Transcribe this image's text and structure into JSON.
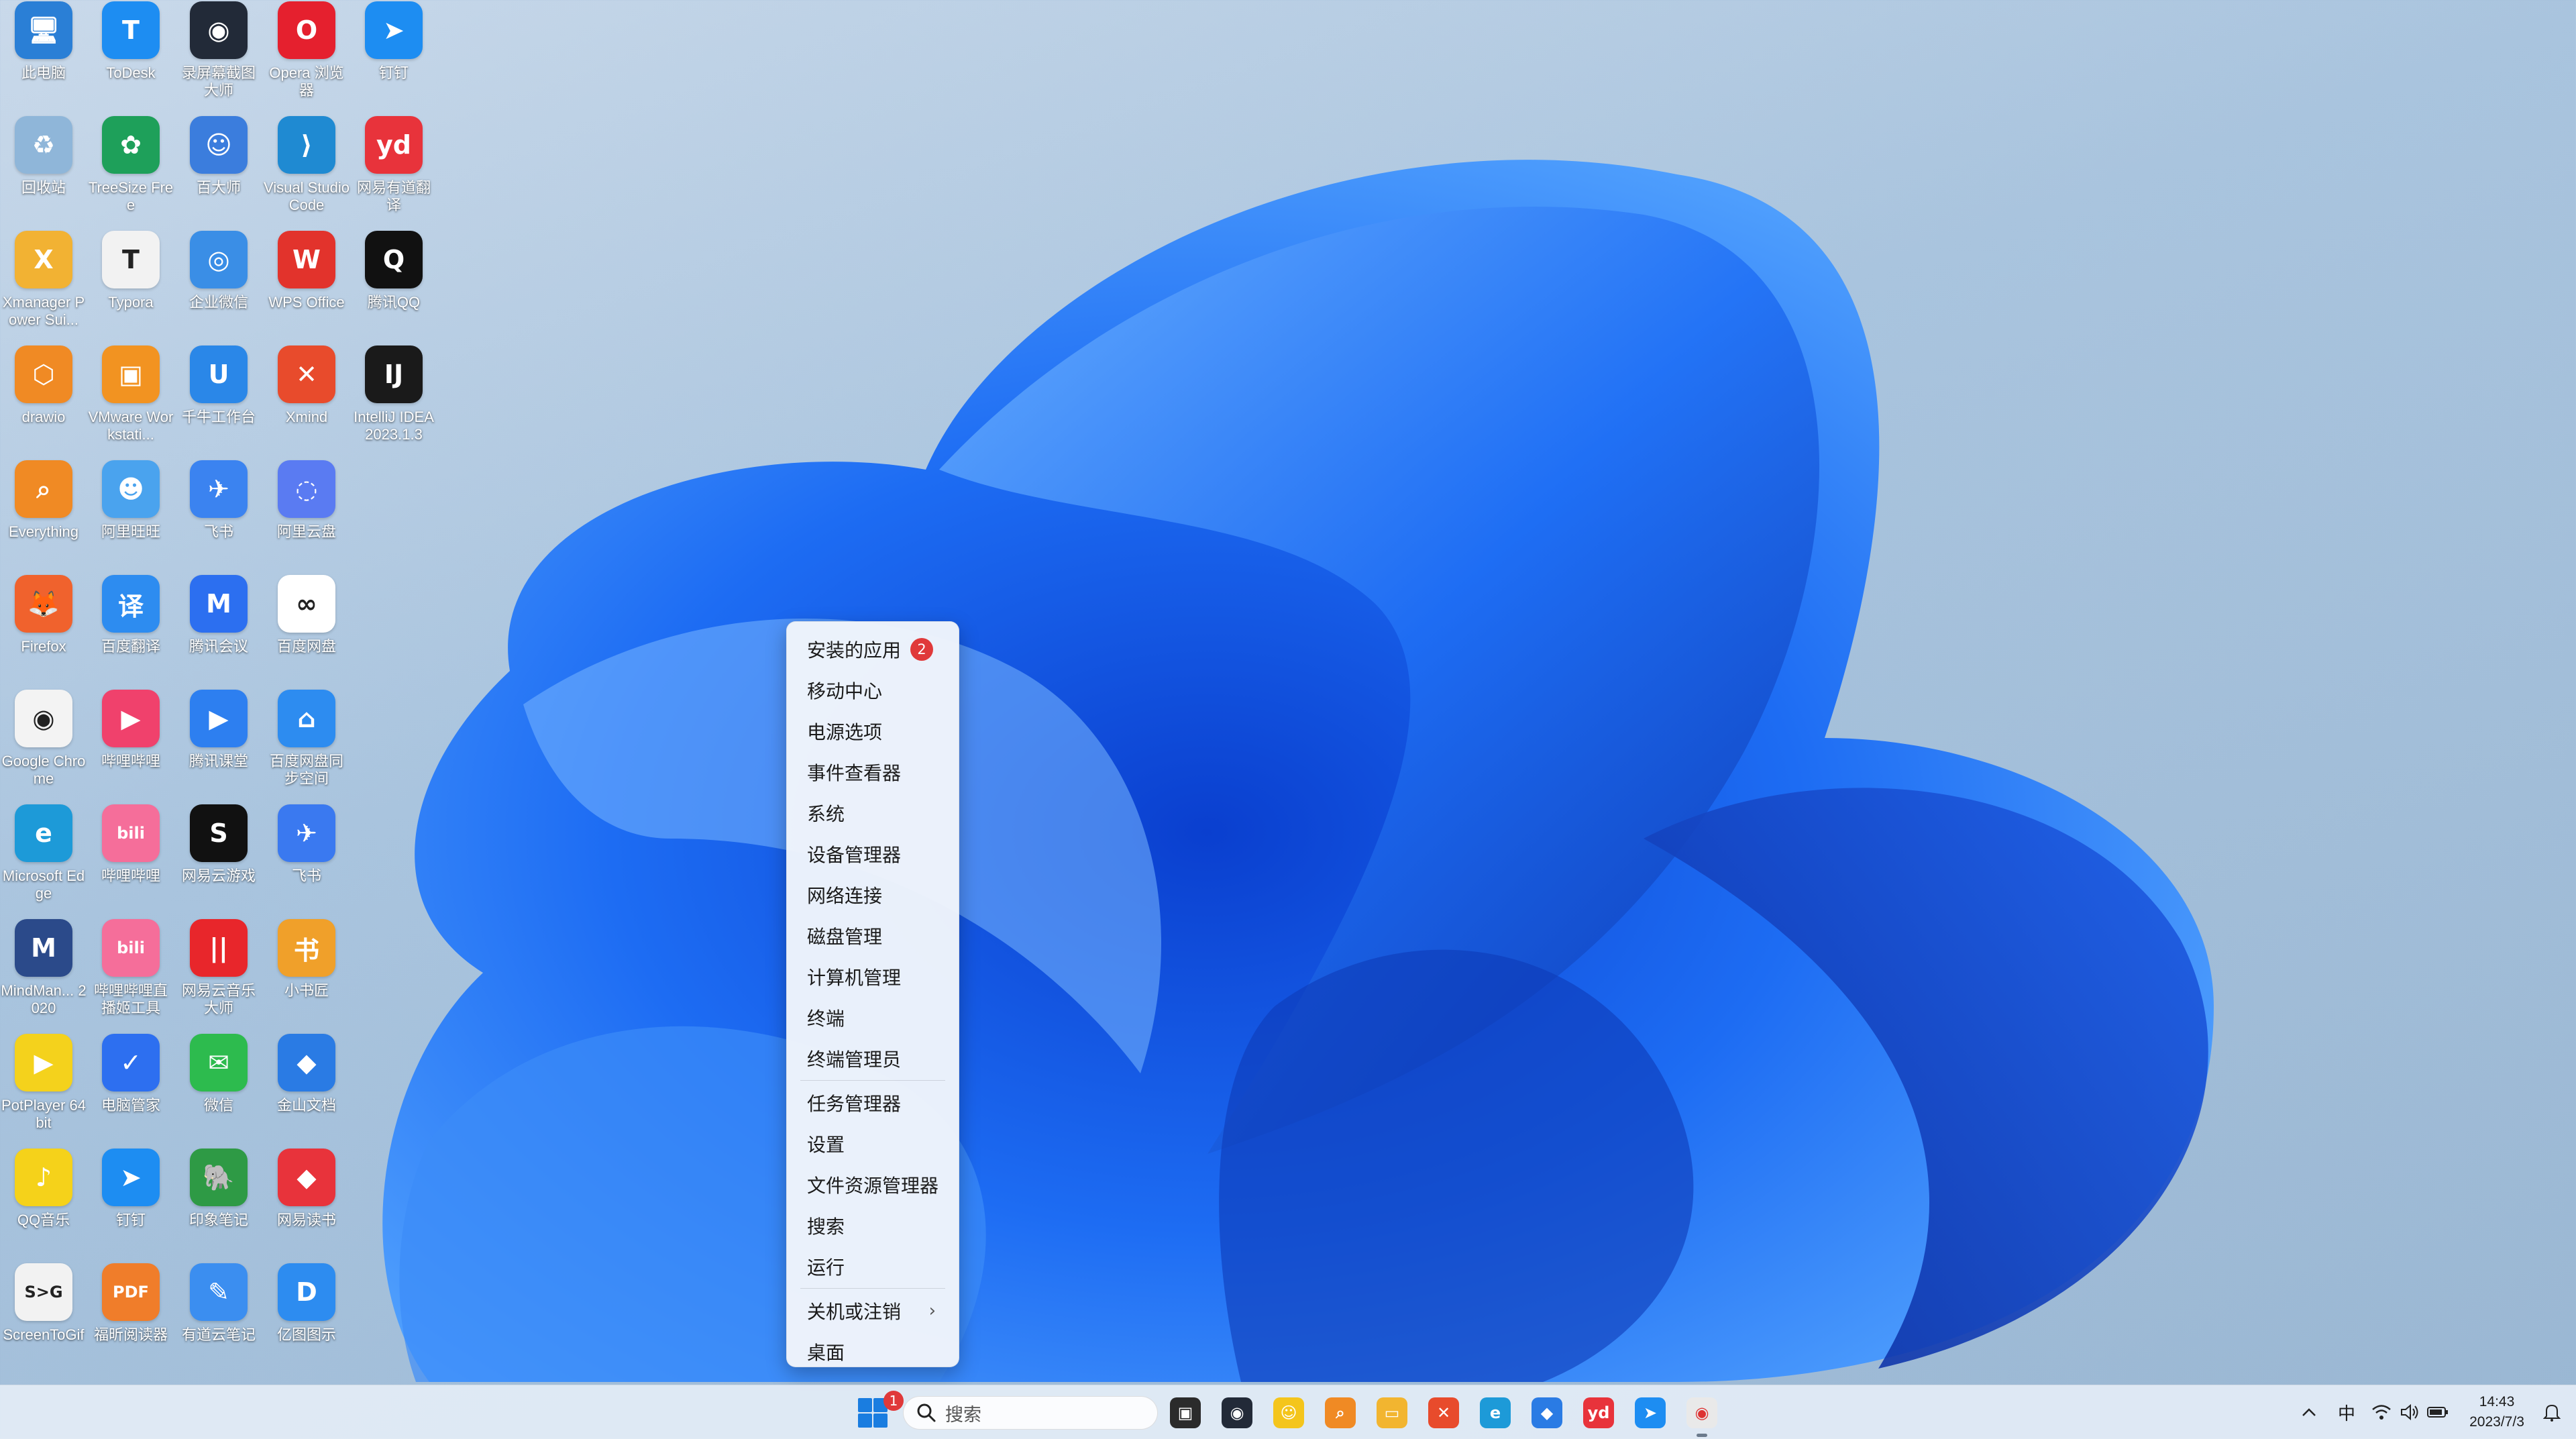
{
  "desktop": {
    "icons": [
      {
        "label": "此电脑",
        "color": "#2a7fd6",
        "glyph": "🖥"
      },
      {
        "label": "ToDesk",
        "color": "#1d8df2",
        "glyph": "T"
      },
      {
        "label": "录屏幕截图大师",
        "color": "#222a38",
        "glyph": "◉"
      },
      {
        "label": "Opera 浏览器",
        "color": "#e5202e",
        "glyph": "O"
      },
      {
        "label": "钉钉",
        "color": "#1d8df2",
        "glyph": "➤"
      },
      {
        "label": "回收站",
        "color": "#8fb6d9",
        "glyph": "♻"
      },
      {
        "label": "TreeSize Free",
        "color": "#1ea05a",
        "glyph": "✿"
      },
      {
        "label": "百大师",
        "color": "#3b7ddd",
        "glyph": "☺"
      },
      {
        "label": "Visual Studio Code",
        "color": "#1f8ad2",
        "glyph": "⟩"
      },
      {
        "label": "网易有道翻译",
        "color": "#e8333b",
        "glyph": "yd"
      },
      {
        "label": "Xmanager Power Sui...",
        "color": "#f2b233",
        "glyph": "X"
      },
      {
        "label": "Typora",
        "color": "#f2f2f2",
        "glyph": "T"
      },
      {
        "label": "企业微信",
        "color": "#3a8ee6",
        "glyph": "◎"
      },
      {
        "label": "WPS Office",
        "color": "#e2332c",
        "glyph": "W"
      },
      {
        "label": "腾讯QQ",
        "color": "#111111",
        "glyph": "Q"
      },
      {
        "label": "drawio",
        "color": "#f08a24",
        "glyph": "⬡"
      },
      {
        "label": "VMware Workstati...",
        "color": "#f29321",
        "glyph": "▣"
      },
      {
        "label": "千牛工作台",
        "color": "#2a87e8",
        "glyph": "U"
      },
      {
        "label": "Xmind",
        "color": "#e84b2c",
        "glyph": "✕"
      },
      {
        "label": "IntelliJ IDEA 2023.1.3",
        "color": "#1a1a1a",
        "glyph": "IJ"
      },
      {
        "label": "Everything",
        "color": "#f08a24",
        "glyph": "⌕"
      },
      {
        "label": "阿里旺旺",
        "color": "#4aa3ee",
        "glyph": "☻"
      },
      {
        "label": "飞书",
        "color": "#3b83f0",
        "glyph": "✈"
      },
      {
        "label": "阿里云盘",
        "color": "#5a7bf2",
        "glyph": "◌"
      },
      {
        "label": "Firefox",
        "color": "#f0622d",
        "glyph": "🦊"
      },
      {
        "label": "百度翻译",
        "color": "#2d8cf0",
        "glyph": "译"
      },
      {
        "label": "腾讯会议",
        "color": "#2c6ff0",
        "glyph": "M"
      },
      {
        "label": "百度网盘",
        "color": "#ffffff",
        "glyph": "∞"
      },
      {
        "label": "Google Chrome",
        "color": "#f3f3f3",
        "glyph": "◉"
      },
      {
        "label": "哔哩哔哩",
        "color": "#f0416c",
        "glyph": "▶"
      },
      {
        "label": "腾讯课堂",
        "color": "#2d7ff0",
        "glyph": "▶"
      },
      {
        "label": "百度网盘同步空间",
        "color": "#2d8cf0",
        "glyph": "⌂"
      },
      {
        "label": "Microsoft Edge",
        "color": "#1d9ad8",
        "glyph": "e"
      },
      {
        "label": "哔哩哔哩",
        "color": "#f56e9a",
        "glyph": "bili"
      },
      {
        "label": "网易云游戏",
        "color": "#111111",
        "glyph": "S"
      },
      {
        "label": "飞书",
        "color": "#3a79f0",
        "glyph": "✈"
      },
      {
        "label": "MindMan... 2020",
        "color": "#2b4a8a",
        "glyph": "M"
      },
      {
        "label": "哔哩哔哩直播姬工具",
        "color": "#f56e9a",
        "glyph": "bili"
      },
      {
        "label": "网易云音乐大师",
        "color": "#e8262b",
        "glyph": "||"
      },
      {
        "label": "小书匠",
        "color": "#f0a02a",
        "glyph": "书"
      },
      {
        "label": "PotPlayer 64 bit",
        "color": "#f4d21c",
        "glyph": "▶"
      },
      {
        "label": "电脑管家",
        "color": "#2d6ff0",
        "glyph": "✓"
      },
      {
        "label": "微信",
        "color": "#2dbb4e",
        "glyph": "✉"
      },
      {
        "label": "金山文档",
        "color": "#2a7be4",
        "glyph": "◆"
      },
      {
        "label": "QQ音乐",
        "color": "#f5d21a",
        "glyph": "♪"
      },
      {
        "label": "钉钉",
        "color": "#1d8df2",
        "glyph": "➤"
      },
      {
        "label": "印象笔记",
        "color": "#2e9a45",
        "glyph": "🐘"
      },
      {
        "label": "网易读书",
        "color": "#e8333b",
        "glyph": "◆"
      },
      {
        "label": "ScreenToGif",
        "color": "#f2f2f2",
        "glyph": "S>G"
      },
      {
        "label": "福昕阅读器",
        "color": "#f07d2a",
        "glyph": "PDF"
      },
      {
        "label": "有道云笔记",
        "color": "#3b8ef0",
        "glyph": "✎"
      },
      {
        "label": "亿图图示",
        "color": "#2d8cf0",
        "glyph": "D"
      }
    ]
  },
  "context_menu": {
    "items": [
      {
        "label": "安装的应用",
        "badge": "2"
      },
      {
        "label": "移动中心"
      },
      {
        "label": "电源选项"
      },
      {
        "label": "事件查看器"
      },
      {
        "label": "系统"
      },
      {
        "label": "设备管理器"
      },
      {
        "label": "网络连接"
      },
      {
        "label": "磁盘管理"
      },
      {
        "label": "计算机管理"
      },
      {
        "label": "终端"
      },
      {
        "label": "终端管理员"
      },
      {
        "label": "任务管理器"
      },
      {
        "label": "设置"
      },
      {
        "label": "文件资源管理器"
      },
      {
        "label": "搜索"
      },
      {
        "label": "运行"
      },
      {
        "label": "关机或注销",
        "submenu": "›"
      },
      {
        "label": "桌面"
      }
    ]
  },
  "taskbar": {
    "start_badge": "1",
    "search_placeholder": "搜索",
    "apps": [
      {
        "name": "task-view",
        "glyph": "▣",
        "color": "#2b2b2b"
      },
      {
        "name": "screen-recorder",
        "glyph": "◉",
        "color": "#222a38"
      },
      {
        "name": "sticky",
        "glyph": "☺",
        "color": "#f4c51c"
      },
      {
        "name": "everything",
        "glyph": "⌕",
        "color": "#f08a24"
      },
      {
        "name": "file-explorer",
        "glyph": "▭",
        "color": "#f2b530"
      },
      {
        "name": "xmind",
        "glyph": "✕",
        "color": "#e84b2c"
      },
      {
        "name": "edge",
        "glyph": "e",
        "color": "#1d9ad8"
      },
      {
        "name": "kingsoft-docs",
        "glyph": "◆",
        "color": "#2a7be4"
      },
      {
        "name": "youdao",
        "glyph": "yd",
        "color": "#e8333b"
      },
      {
        "name": "dingtalk",
        "glyph": "➤",
        "color": "#1d8df2"
      },
      {
        "name": "chrome",
        "glyph": "◉",
        "color": "#e9e9e9"
      }
    ],
    "tray": {
      "chevron": "^",
      "ime": "中",
      "wifi": "wifi",
      "volume": "volume",
      "battery": "battery"
    },
    "clock": {
      "time": "14:43",
      "date": "2023/7/3"
    }
  }
}
